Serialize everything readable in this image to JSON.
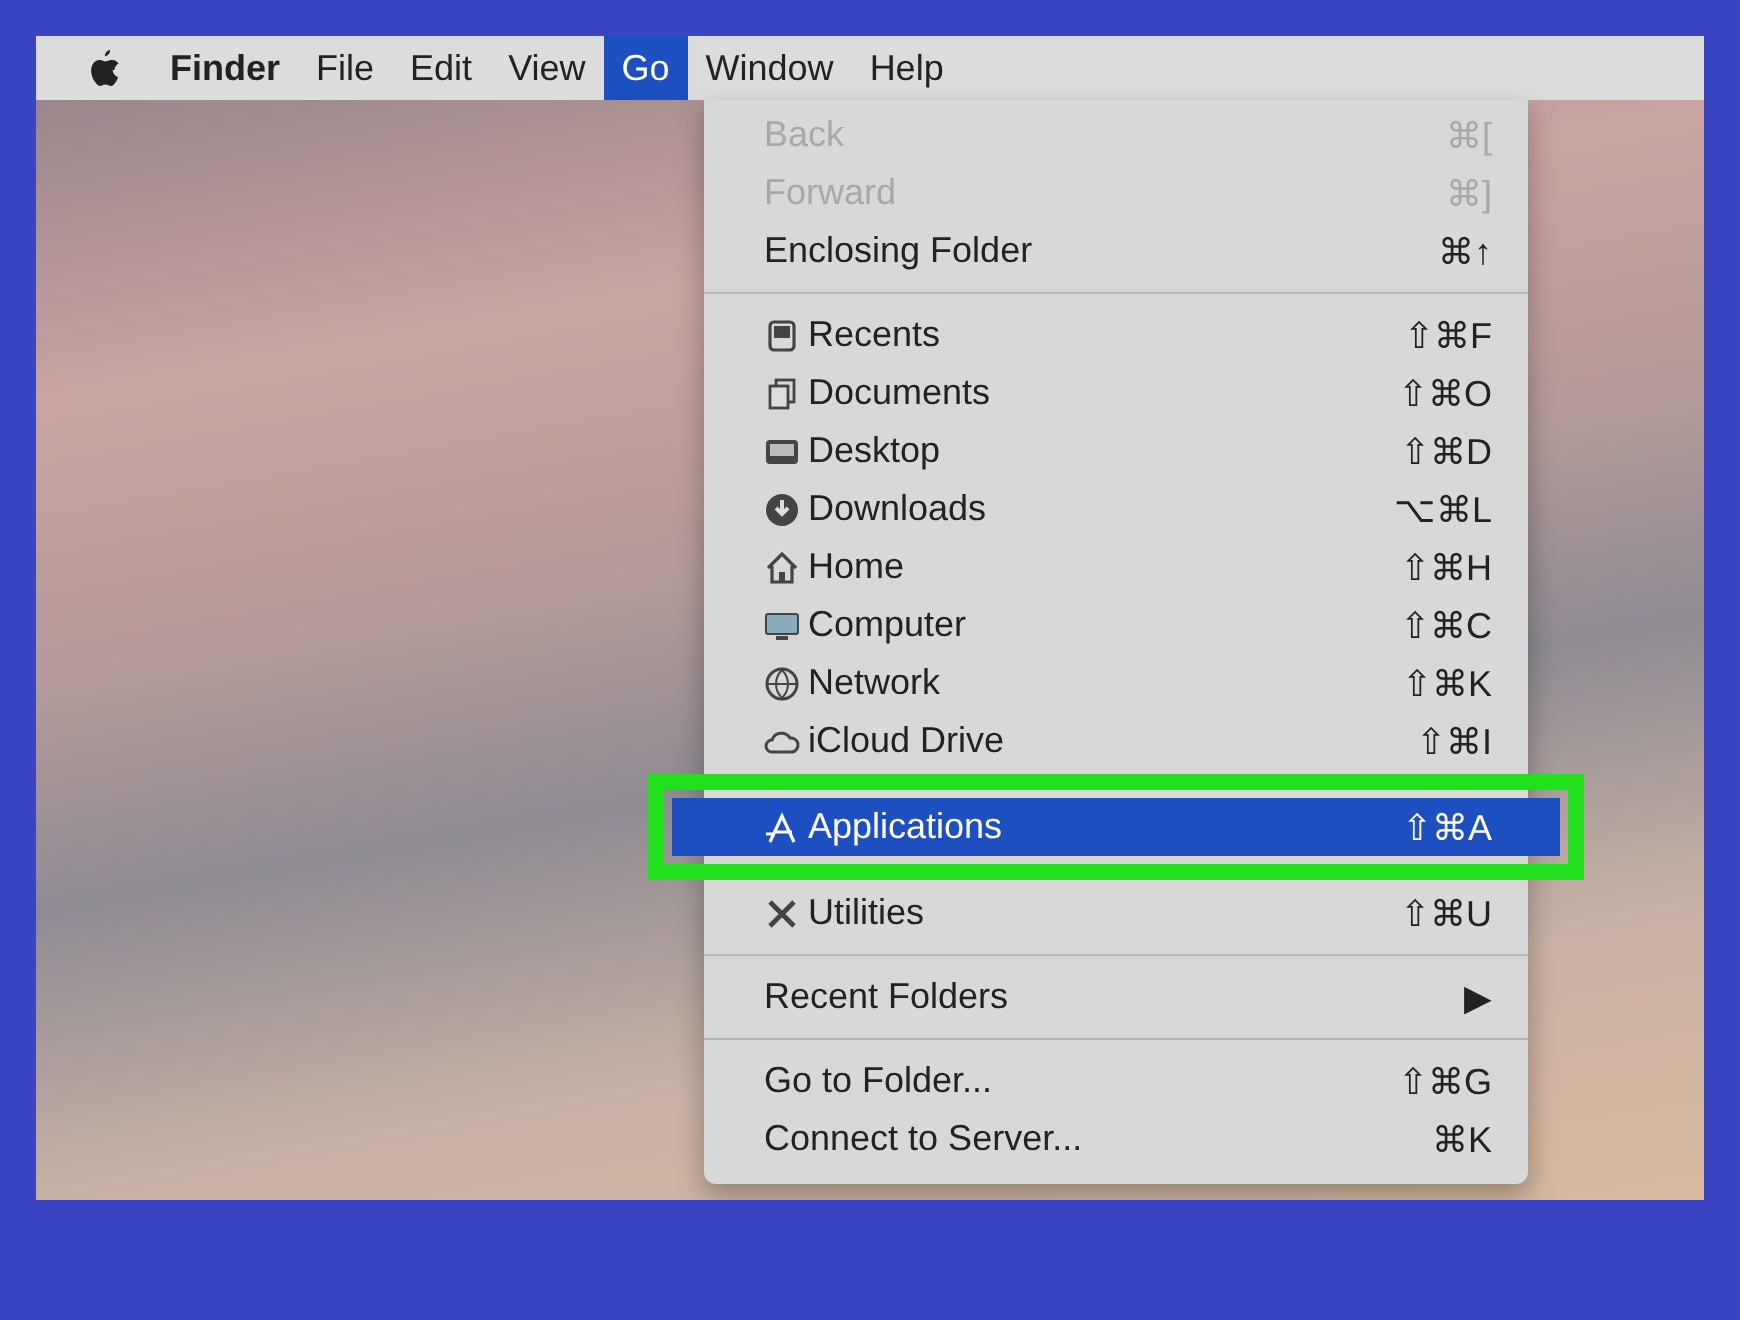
{
  "menu_bar": {
    "items": [
      {
        "label": "Finder",
        "kind": "app",
        "selected": false
      },
      {
        "label": "File",
        "kind": "menu",
        "selected": false
      },
      {
        "label": "Edit",
        "kind": "menu",
        "selected": false
      },
      {
        "label": "View",
        "kind": "menu",
        "selected": false
      },
      {
        "label": "Go",
        "kind": "menu",
        "selected": true
      },
      {
        "label": "Window",
        "kind": "menu",
        "selected": false
      },
      {
        "label": "Help",
        "kind": "menu",
        "selected": false
      }
    ]
  },
  "go_menu": {
    "items": [
      {
        "kind": "plain",
        "label": "Back",
        "shortcut": "⌘[",
        "disabled": true,
        "selected": false
      },
      {
        "kind": "plain",
        "label": "Forward",
        "shortcut": "⌘]",
        "disabled": true,
        "selected": false
      },
      {
        "kind": "plain",
        "label": "Enclosing Folder",
        "shortcut": "⌘↑",
        "disabled": false,
        "selected": false
      },
      {
        "kind": "separator"
      },
      {
        "kind": "icon",
        "label": "Recents",
        "shortcut": "⇧⌘F",
        "disabled": false,
        "selected": false
      },
      {
        "kind": "icon",
        "label": "Documents",
        "shortcut": "⇧⌘O",
        "disabled": false,
        "selected": false
      },
      {
        "kind": "icon",
        "label": "Desktop",
        "shortcut": "⇧⌘D",
        "disabled": false,
        "selected": false
      },
      {
        "kind": "icon",
        "label": "Downloads",
        "shortcut": "⌥⌘L",
        "disabled": false,
        "selected": false
      },
      {
        "kind": "icon",
        "label": "Home",
        "shortcut": "⇧⌘H",
        "disabled": false,
        "selected": false
      },
      {
        "kind": "icon",
        "label": "Computer",
        "shortcut": "⇧⌘C",
        "disabled": false,
        "selected": false
      },
      {
        "kind": "icon",
        "label": "Network",
        "shortcut": "⇧⌘K",
        "disabled": false,
        "selected": false
      },
      {
        "kind": "icon",
        "label": "iCloud Drive",
        "shortcut": "⇧⌘I",
        "disabled": false,
        "selected": false
      },
      {
        "kind": "icon",
        "label": "Applications",
        "shortcut": "⇧⌘A",
        "disabled": false,
        "selected": true
      },
      {
        "kind": "icon",
        "label": "Utilities",
        "shortcut": "⇧⌘U",
        "disabled": false,
        "selected": false
      },
      {
        "kind": "separator"
      },
      {
        "kind": "submenu",
        "label": "Recent Folders",
        "shortcut": "▶",
        "disabled": false,
        "selected": false
      },
      {
        "kind": "separator"
      },
      {
        "kind": "plain",
        "label": "Go to Folder...",
        "shortcut": "⇧⌘G",
        "disabled": false,
        "selected": false
      },
      {
        "kind": "plain",
        "label": "Connect to Server...",
        "shortcut": "⌘K",
        "disabled": false,
        "selected": false
      }
    ]
  }
}
